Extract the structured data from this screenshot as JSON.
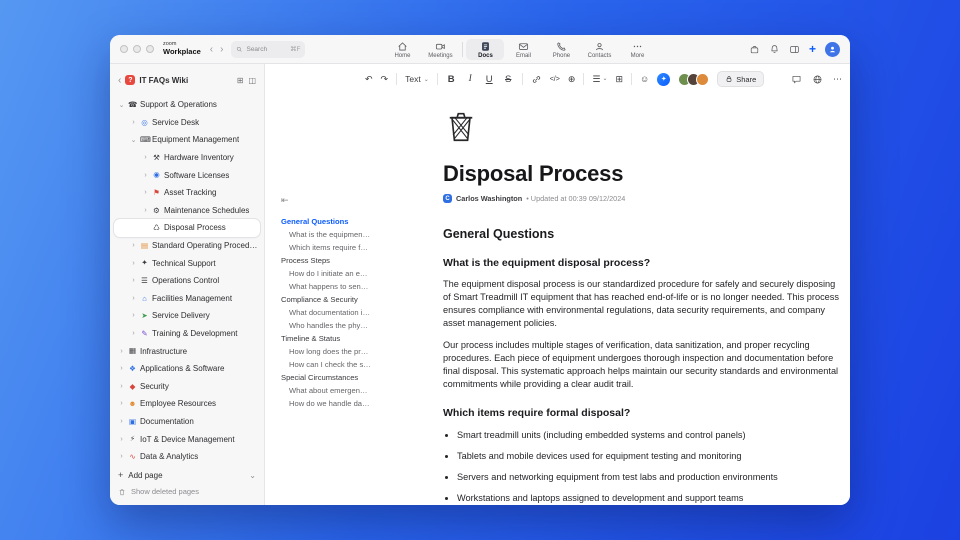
{
  "chrome": {
    "logo_top": "zoom",
    "logo_bottom": "Workplace",
    "search": {
      "text": "Search",
      "shortcut": "⌘F"
    },
    "nav": [
      {
        "label": "Home",
        "active": false
      },
      {
        "label": "Meetings",
        "active": false
      },
      {
        "label": "Docs",
        "active": true
      },
      {
        "label": "Email",
        "active": false
      },
      {
        "label": "Phone",
        "active": false
      },
      {
        "label": "Contacts",
        "active": false
      },
      {
        "label": "More",
        "active": false
      }
    ]
  },
  "sidebar": {
    "badge": "?",
    "title": "IT FAQs Wiki",
    "items": [
      {
        "label": "Support & Operations",
        "level": 0,
        "chevron": "⌄",
        "icon": "☎",
        "icon_class": "dark",
        "selected": false
      },
      {
        "label": "Service Desk",
        "level": 1,
        "chevron": "›",
        "icon": "◎",
        "icon_class": "blue",
        "selected": false
      },
      {
        "label": "Equipment Management",
        "level": 1,
        "chevron": "⌄",
        "icon": "⌨",
        "icon_class": "dark",
        "selected": false
      },
      {
        "label": "Hardware Inventory",
        "level": 2,
        "chevron": "›",
        "icon": "⚒",
        "icon_class": "dark",
        "selected": false
      },
      {
        "label": "Software Licenses",
        "level": 2,
        "chevron": "›",
        "icon": "◉",
        "icon_class": "blue",
        "selected": false
      },
      {
        "label": "Asset Tracking",
        "level": 2,
        "chevron": "›",
        "icon": "⚑",
        "icon_class": "red",
        "selected": false
      },
      {
        "label": "Maintenance Schedules",
        "level": 2,
        "chevron": "›",
        "icon": "⚙",
        "icon_class": "dark",
        "selected": false
      },
      {
        "label": "Disposal Process",
        "level": 2,
        "chevron": "",
        "icon": "♺",
        "icon_class": "dark",
        "selected": true
      },
      {
        "label": "Standard Operating Procedures",
        "level": 1,
        "chevron": "›",
        "icon": "▤",
        "icon_class": "orange",
        "selected": false
      },
      {
        "label": "Technical Support",
        "level": 1,
        "chevron": "›",
        "icon": "✦",
        "icon_class": "dark",
        "selected": false
      },
      {
        "label": "Operations Control",
        "level": 1,
        "chevron": "›",
        "icon": "☰",
        "icon_class": "dark",
        "selected": false
      },
      {
        "label": "Facilities Management",
        "level": 1,
        "chevron": "›",
        "icon": "⌂",
        "icon_class": "blue",
        "selected": false
      },
      {
        "label": "Service Delivery",
        "level": 1,
        "chevron": "›",
        "icon": "➤",
        "icon_class": "green",
        "selected": false
      },
      {
        "label": "Training & Development",
        "level": 1,
        "chevron": "›",
        "icon": "✎",
        "icon_class": "purple",
        "selected": false
      },
      {
        "label": "Infrastructure",
        "level": 0,
        "chevron": "›",
        "icon": "▦",
        "icon_class": "dark",
        "selected": false
      },
      {
        "label": "Applications & Software",
        "level": 0,
        "chevron": "›",
        "icon": "❖",
        "icon_class": "blue",
        "selected": false
      },
      {
        "label": "Security",
        "level": 0,
        "chevron": "›",
        "icon": "◆",
        "icon_class": "red",
        "selected": false
      },
      {
        "label": "Employee Resources",
        "level": 0,
        "chevron": "›",
        "icon": "☻",
        "icon_class": "orange",
        "selected": false
      },
      {
        "label": "Documentation",
        "level": 0,
        "chevron": "›",
        "icon": "▣",
        "icon_class": "blue",
        "selected": false
      },
      {
        "label": "IoT & Device Management",
        "level": 0,
        "chevron": "›",
        "icon": "⚡",
        "icon_class": "dark",
        "selected": false
      },
      {
        "label": "Data & Analytics",
        "level": 0,
        "chevron": "›",
        "icon": "∿",
        "icon_class": "red",
        "selected": false
      }
    ],
    "add_page": "Add page",
    "show_deleted": "Show deleted pages"
  },
  "toolbar": {
    "text_style": "Text",
    "format": {
      "bold": "B",
      "italic": "I",
      "underline": "U",
      "strike": "S"
    },
    "code": "</>",
    "share": "Share"
  },
  "toc": {
    "items": [
      {
        "label": "General Questions",
        "type": "section",
        "active": true
      },
      {
        "label": "What is the equipment disp...",
        "type": "sub",
        "active": false
      },
      {
        "label": "Which items require formal ...",
        "type": "sub",
        "active": false
      },
      {
        "label": "Process Steps",
        "type": "section",
        "active": false
      },
      {
        "label": "How do I initiate an equipm...",
        "type": "sub",
        "active": false
      },
      {
        "label": "What happens to sensitive ...",
        "type": "sub",
        "active": false
      },
      {
        "label": "Compliance & Security",
        "type": "section",
        "active": false
      },
      {
        "label": "What documentation is req...",
        "type": "sub",
        "active": false
      },
      {
        "label": "Who handles the physical di...",
        "type": "sub",
        "active": false
      },
      {
        "label": "Timeline & Status",
        "type": "section",
        "active": false
      },
      {
        "label": "How long does the process ...",
        "type": "sub",
        "active": false
      },
      {
        "label": "How can I check the status ...",
        "type": "sub",
        "active": false
      },
      {
        "label": "Special Circumstances",
        "type": "section",
        "active": false
      },
      {
        "label": "What about emergency dis...",
        "type": "sub",
        "active": false
      },
      {
        "label": "How do we handle damage...",
        "type": "sub",
        "active": false
      }
    ]
  },
  "doc": {
    "title": "Disposal Process",
    "author_initial": "C",
    "author": "Carlos Washington",
    "updated": "• Updated at 00:39 09/12/2024",
    "h2": "General Questions",
    "q1": "What is the equipment disposal process?",
    "p1": "The equipment disposal process is our standardized procedure for safely and securely disposing of Smart Treadmill IT equipment that has reached end-of-life or is no longer needed. This process ensures compliance with environmental regulations, data security requirements, and company asset management policies.",
    "p2": "Our process includes multiple stages of verification, data sanitization, and proper recycling procedures. Each piece of equipment undergoes thorough inspection and documentation before final disposal. This systematic approach helps maintain our security standards and environmental commitments while providing a clear audit trail.",
    "q2": "Which items require formal disposal?",
    "bullets": [
      "Smart treadmill units (including embedded systems and control panels)",
      "Tablets and mobile devices used for equipment testing and monitoring",
      "Servers and networking equipment from test labs and production environments",
      "Workstations and laptops assigned to development and support teams"
    ]
  }
}
